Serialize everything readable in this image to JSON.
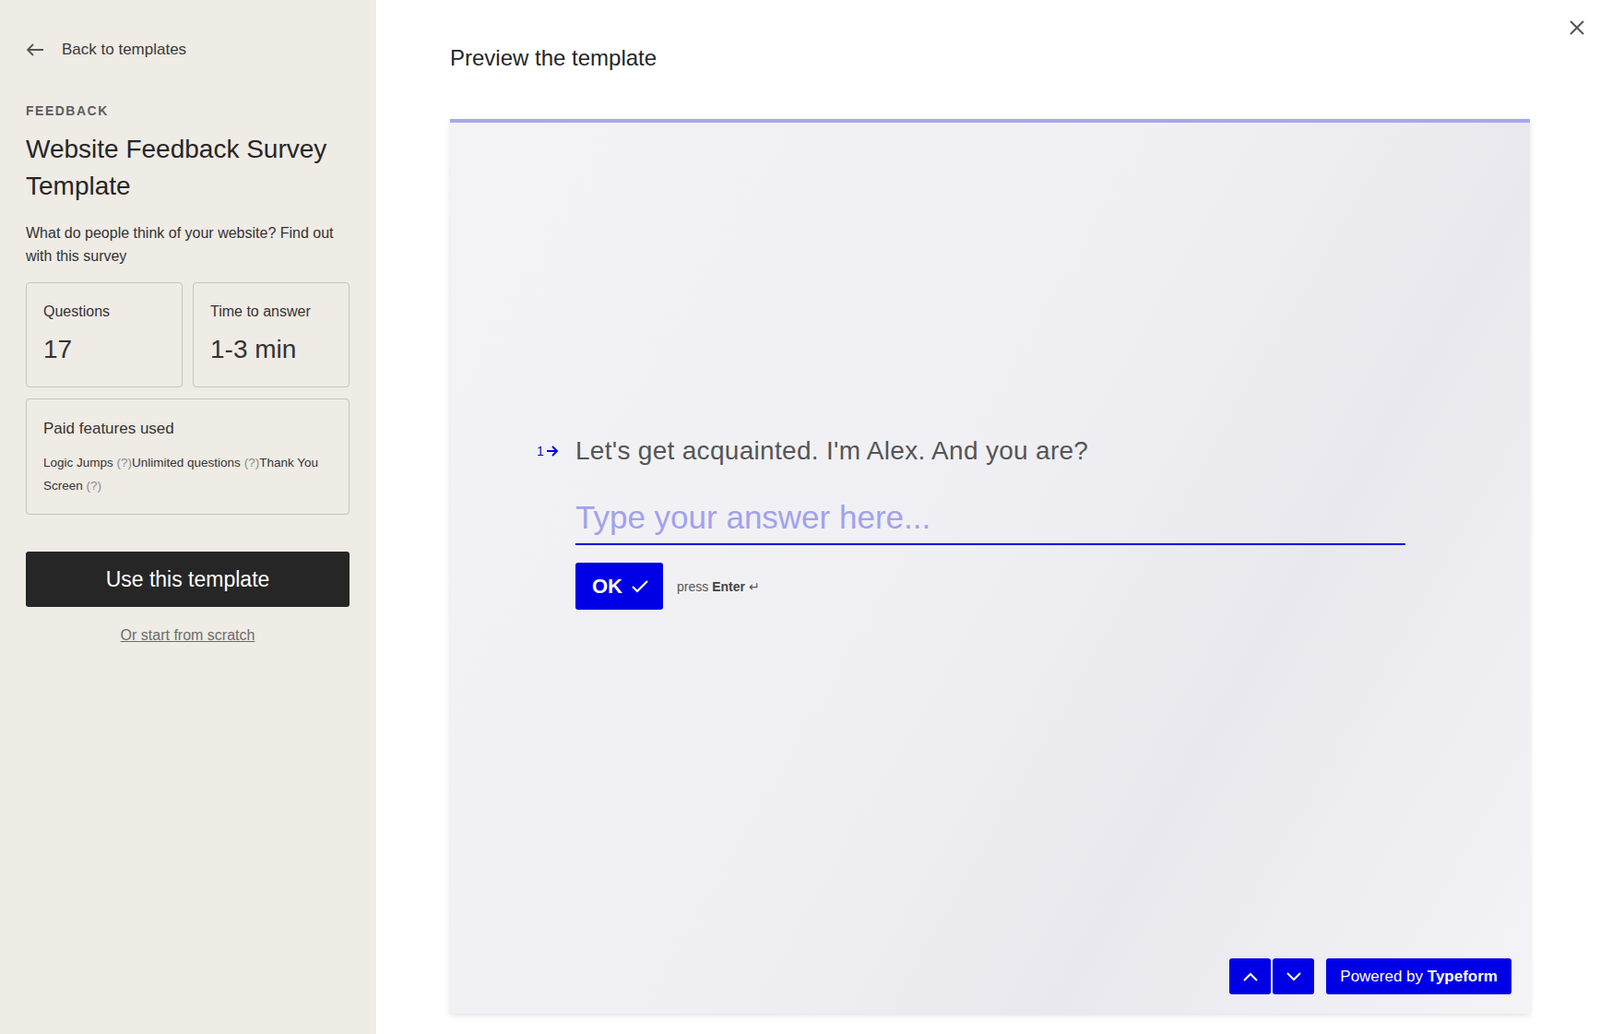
{
  "sidebar": {
    "back_link": "Back to templates",
    "category": "FEEDBACK",
    "title": "Website Feedback Survey Template",
    "description": "What do people think of your website? Find out with this survey",
    "stats": [
      {
        "label": "Questions",
        "value": "17"
      },
      {
        "label": "Time to answer",
        "value": "1-3 min"
      }
    ],
    "paid_features": {
      "label": "Paid features used",
      "items": [
        {
          "name": "Logic Jumps",
          "hint": "(?)"
        },
        {
          "name": "Unlimited questions",
          "hint": "(?)"
        },
        {
          "name": "Thank You Screen",
          "hint": "(?)"
        }
      ]
    },
    "primary_button": "Use this template",
    "secondary_link": "Or start from scratch"
  },
  "preview": {
    "heading": "Preview the template",
    "question": {
      "number": "1",
      "text": "Let's get acquainted. I'm Alex. And you are?",
      "placeholder": "Type your answer here...",
      "button": "OK",
      "hint_prefix": "press",
      "hint_key": "Enter",
      "hint_icon": "↵"
    },
    "badge": {
      "prefix": "Powered by",
      "brand": "Typeform"
    }
  }
}
